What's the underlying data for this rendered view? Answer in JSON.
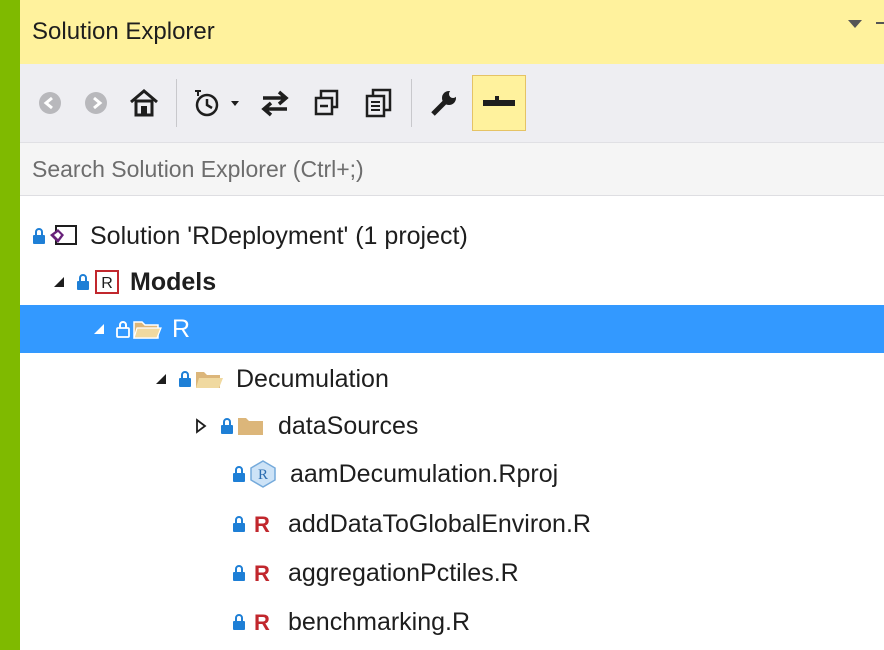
{
  "window": {
    "title": "Solution Explorer"
  },
  "toolbar": {
    "buttons": [
      {
        "name": "back-icon"
      },
      {
        "name": "forward-icon"
      },
      {
        "name": "home-icon"
      },
      {
        "name": "pending-changes-filter-icon"
      },
      {
        "name": "sync-with-active-document-icon"
      },
      {
        "name": "collapse-all-icon"
      },
      {
        "name": "show-all-files-icon"
      },
      {
        "name": "properties-wrench-icon"
      },
      {
        "name": "preview-selected-items-icon"
      }
    ]
  },
  "search": {
    "placeholder": "Search Solution Explorer (Ctrl+;)"
  },
  "tree": {
    "solution": "Solution 'RDeployment' (1 project)",
    "project": "Models",
    "folder_r": "R",
    "folder_decumulation": "Decumulation",
    "folder_datasources": "dataSources",
    "file_rproj": "aamDecumulation.Rproj",
    "file_1": "addDataToGlobalEnviron.R",
    "file_2": "aggregationPctiles.R",
    "file_3": "benchmarking.R"
  },
  "colors": {
    "frame": "#7fba00",
    "titlebar": "#fff29d",
    "selection": "#3399ff",
    "r_file": "#c1272d"
  }
}
